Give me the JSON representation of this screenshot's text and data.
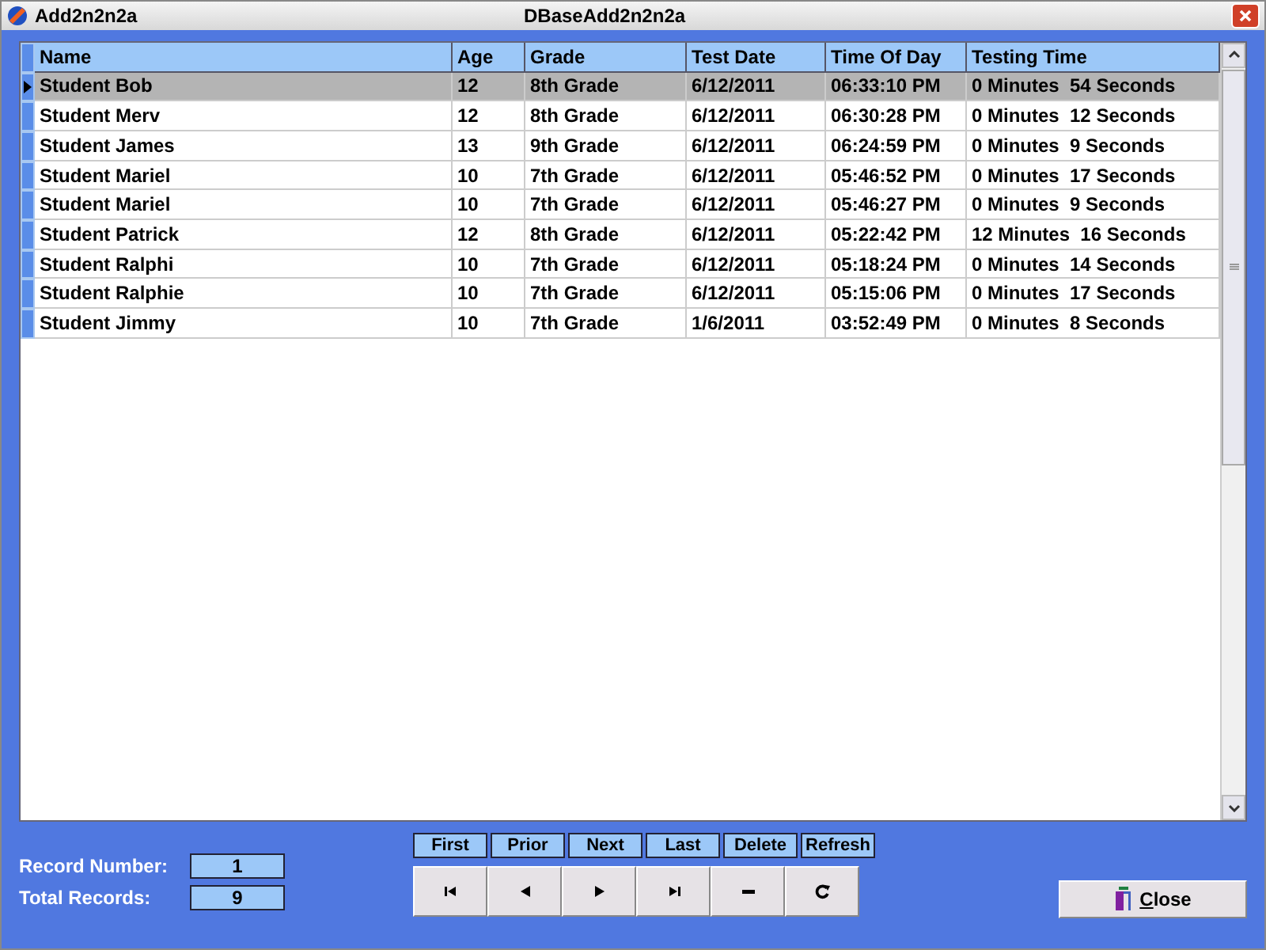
{
  "window": {
    "title": "Add2n2n2a",
    "caption": "DBaseAdd2n2n2a"
  },
  "table": {
    "columns": [
      "Name",
      "Age",
      "Grade",
      "Test Date",
      "Time Of Day",
      "Testing Time"
    ],
    "rows": [
      {
        "selected": true,
        "cells": [
          "Student Bob",
          "12",
          "8th Grade",
          "6/12/2011",
          "06:33:10 PM",
          "0 Minutes  54 Seconds"
        ]
      },
      {
        "selected": false,
        "cells": [
          "Student Merv",
          "12",
          "8th Grade",
          "6/12/2011",
          "06:30:28 PM",
          "0 Minutes  12 Seconds"
        ]
      },
      {
        "selected": false,
        "cells": [
          "Student James",
          "13",
          "9th Grade",
          "6/12/2011",
          "06:24:59 PM",
          "0 Minutes  9 Seconds"
        ]
      },
      {
        "selected": false,
        "cells": [
          "Student Mariel",
          "10",
          "7th Grade",
          "6/12/2011",
          "05:46:52 PM",
          "0 Minutes  17 Seconds"
        ]
      },
      {
        "selected": false,
        "cells": [
          "Student Mariel",
          "10",
          "7th Grade",
          "6/12/2011",
          "05:46:27 PM",
          "0 Minutes  9 Seconds"
        ]
      },
      {
        "selected": false,
        "cells": [
          "Student Patrick",
          "12",
          "8th Grade",
          "6/12/2011",
          "05:22:42 PM",
          "12 Minutes  16 Seconds"
        ]
      },
      {
        "selected": false,
        "cells": [
          "Student Ralphi",
          "10",
          "7th Grade",
          "6/12/2011",
          "05:18:24 PM",
          "0 Minutes  14 Seconds"
        ]
      },
      {
        "selected": false,
        "cells": [
          "Student Ralphie",
          "10",
          "7th Grade",
          "6/12/2011",
          "05:15:06 PM",
          "0 Minutes  17 Seconds"
        ]
      },
      {
        "selected": false,
        "cells": [
          "Student Jimmy",
          "10",
          "7th Grade",
          "1/6/2011",
          "03:52:49 PM",
          "0 Minutes  8 Seconds"
        ]
      }
    ]
  },
  "record_info": [
    {
      "label": "Record Number:",
      "value": "1"
    },
    {
      "label": "Total Records:",
      "value": "9"
    }
  ],
  "navigator": [
    {
      "label": "First",
      "kind": "first"
    },
    {
      "label": "Prior",
      "kind": "prior"
    },
    {
      "label": "Next",
      "kind": "next"
    },
    {
      "label": "Last",
      "kind": "last"
    },
    {
      "label": "Delete",
      "kind": "delete"
    },
    {
      "label": "Refresh",
      "kind": "refresh"
    }
  ],
  "close_button": {
    "label": "Close"
  }
}
